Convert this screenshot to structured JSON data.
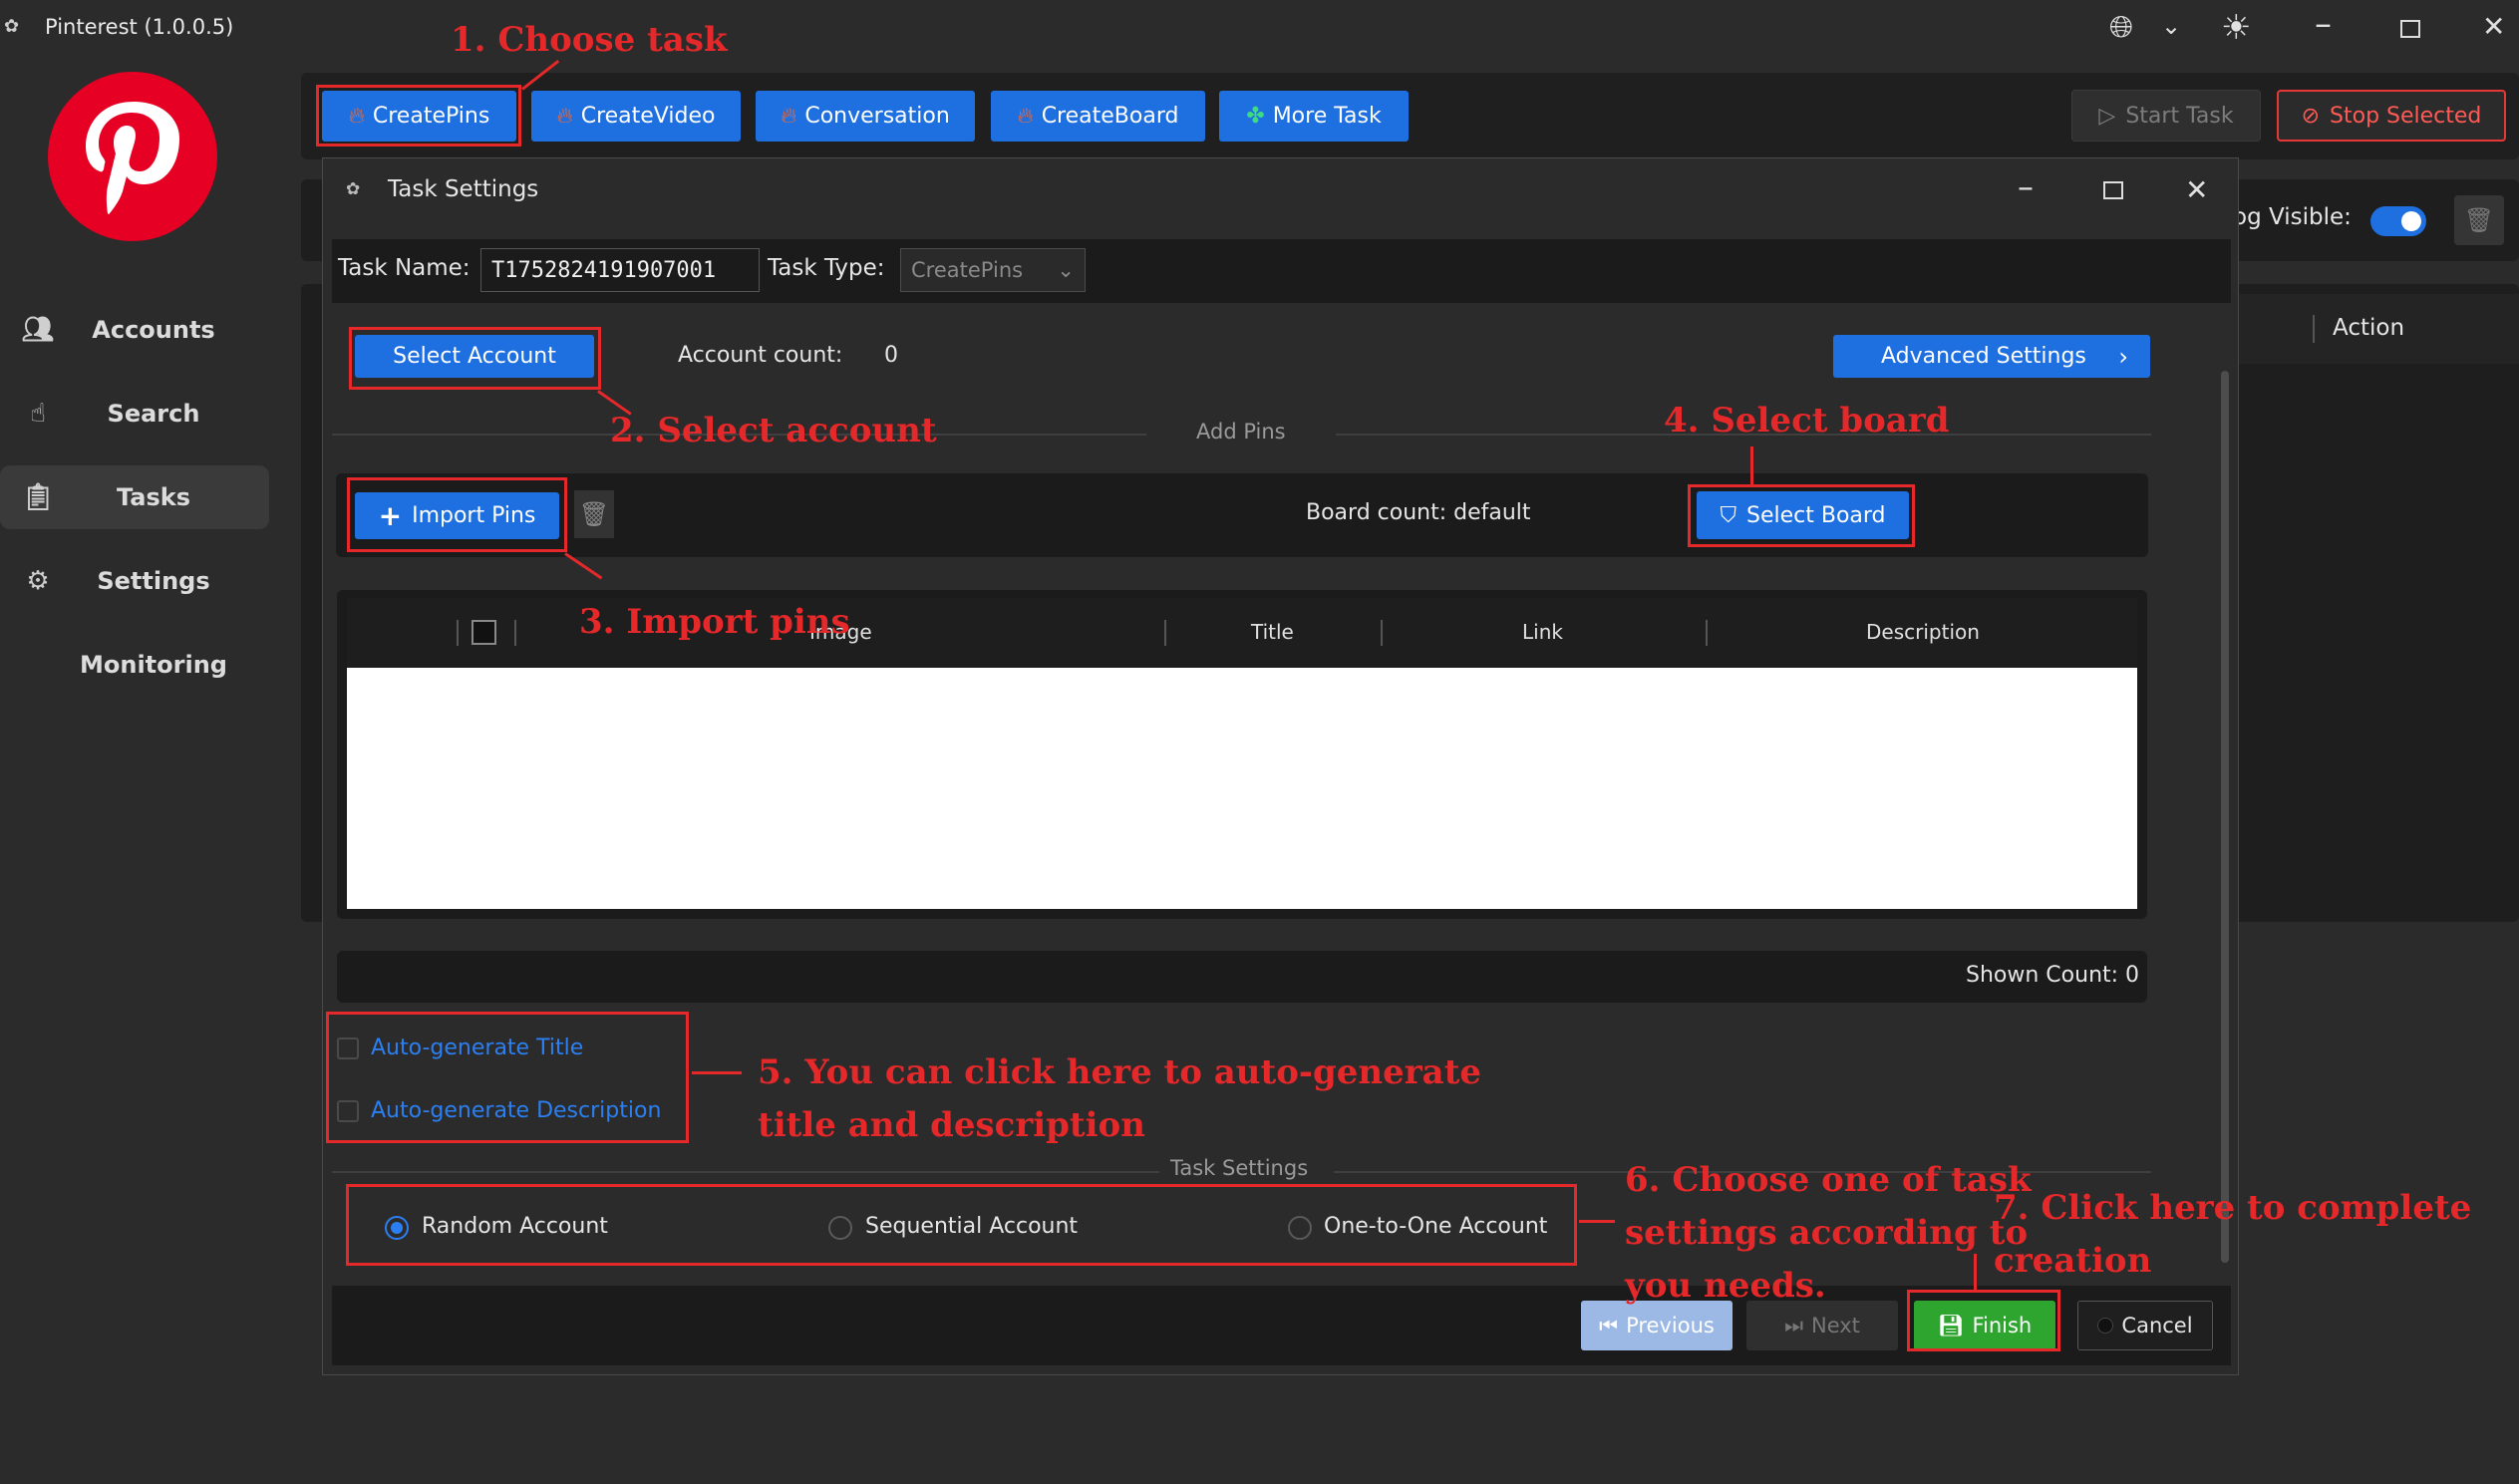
{
  "window": {
    "title": "Pinterest (1.0.0.5)"
  },
  "sidebar": {
    "items": [
      {
        "label": "Accounts",
        "icon": "users-icon"
      },
      {
        "label": "Search",
        "icon": "hand-pointer-icon"
      },
      {
        "label": "Tasks",
        "icon": "clipboard-check-icon"
      },
      {
        "label": "Settings",
        "icon": "gears-icon"
      },
      {
        "label": "Monitoring",
        "icon": ""
      }
    ]
  },
  "toolbar": {
    "tasks": [
      "CreatePins",
      "CreateVideo",
      "Conversation",
      "CreateBoard",
      "More Task"
    ],
    "start_task": "Start Task",
    "stop_selected": "Stop Selected"
  },
  "background": {
    "log_visible": "og Visible:",
    "action_col": "Action"
  },
  "dialog": {
    "title": "Task Settings",
    "task_name_label": "Task Name:",
    "task_name_value": "T1752824191907001",
    "task_type_label": "Task Type:",
    "task_type_value": "CreatePins",
    "select_account": "Select Account",
    "account_count_label": "Account count:",
    "account_count_value": "0",
    "advanced_settings": "Advanced Settings",
    "add_pins_section": "Add Pins",
    "import_pins": "Import Pins",
    "board_count": "Board count: default",
    "select_board": "Select Board",
    "table_columns": [
      "Image",
      "Title",
      "Link",
      "Description"
    ],
    "shown_count": "Shown Count: 0",
    "auto_title": "Auto-generate Title",
    "auto_description": "Auto-generate Description",
    "task_settings_section": "Task Settings",
    "modes": [
      "Random Account",
      "Sequential Account",
      "One-to-One Account"
    ],
    "previous": "Previous",
    "next": "Next",
    "finish": "Finish",
    "cancel": "Cancel"
  },
  "annotations": {
    "a1": "1. Choose task",
    "a2": "2. Select account",
    "a3": "3. Import pins",
    "a4": "4. Select board",
    "a5_l1": "5. You can click here to auto-generate",
    "a5_l2": "title and description",
    "a6_l1": "6. Choose one of task",
    "a6_l2": "settings according to",
    "a6_l3": "you needs.",
    "a7_l1": "7. Click here to complete",
    "a7_l2": "creation"
  },
  "colors": {
    "accent": "#1e6fe0",
    "brand": "#e60023",
    "finish": "#2ea52e",
    "annotation": "#e5282a"
  }
}
